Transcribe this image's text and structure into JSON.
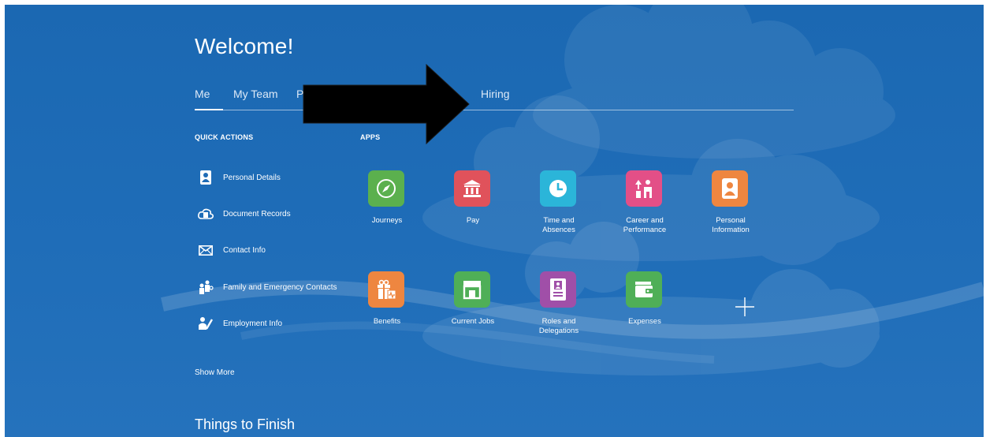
{
  "page": {
    "title": "Welcome!",
    "tabs": [
      {
        "label": "Me"
      },
      {
        "label": "My Team"
      },
      {
        "label": "P"
      },
      {
        "label": "Hiring"
      }
    ]
  },
  "quick_actions": {
    "heading": "QUICK ACTIONS",
    "items": [
      {
        "label": "Personal Details",
        "icon": "person-badge-icon"
      },
      {
        "label": "Document Records",
        "icon": "document-cloud-icon"
      },
      {
        "label": "Contact Info",
        "icon": "envelope-icon"
      },
      {
        "label": "Family and Emergency Contacts",
        "icon": "family-icon"
      },
      {
        "label": "Employment Info",
        "icon": "employee-edit-icon"
      }
    ],
    "show_more": "Show More"
  },
  "apps": {
    "heading": "APPS",
    "tiles": [
      {
        "label": "Journeys",
        "icon": "compass-icon",
        "color": "#5bb04e"
      },
      {
        "label": "Pay",
        "icon": "bank-icon",
        "color": "#e0525b"
      },
      {
        "label": "Time and\nAbsences",
        "icon": "clock-icon",
        "color": "#2bb5d9"
      },
      {
        "label": "Career and\nPerformance",
        "icon": "career-people-icon",
        "color": "#e34f87"
      },
      {
        "label": "Personal\nInformation",
        "icon": "person-badge-icon",
        "color": "#ee8640"
      },
      {
        "label": "Benefits",
        "icon": "gift-icon",
        "color": "#ee8640"
      },
      {
        "label": "Current Jobs",
        "icon": "storefront-icon",
        "color": "#4faf57"
      },
      {
        "label": "Roles and\nDelegations",
        "icon": "id-badge-icon",
        "color": "#a04fa8"
      },
      {
        "label": "Expenses",
        "icon": "wallet-icon",
        "color": "#4faf57"
      }
    ],
    "add_icon": "plus-icon"
  },
  "things_to_finish": {
    "heading": "Things to Finish"
  },
  "overlay": {
    "icon": "black-arrow-right-icon"
  },
  "colors": {
    "background": "#1e6bb5",
    "text": "#ffffff"
  }
}
